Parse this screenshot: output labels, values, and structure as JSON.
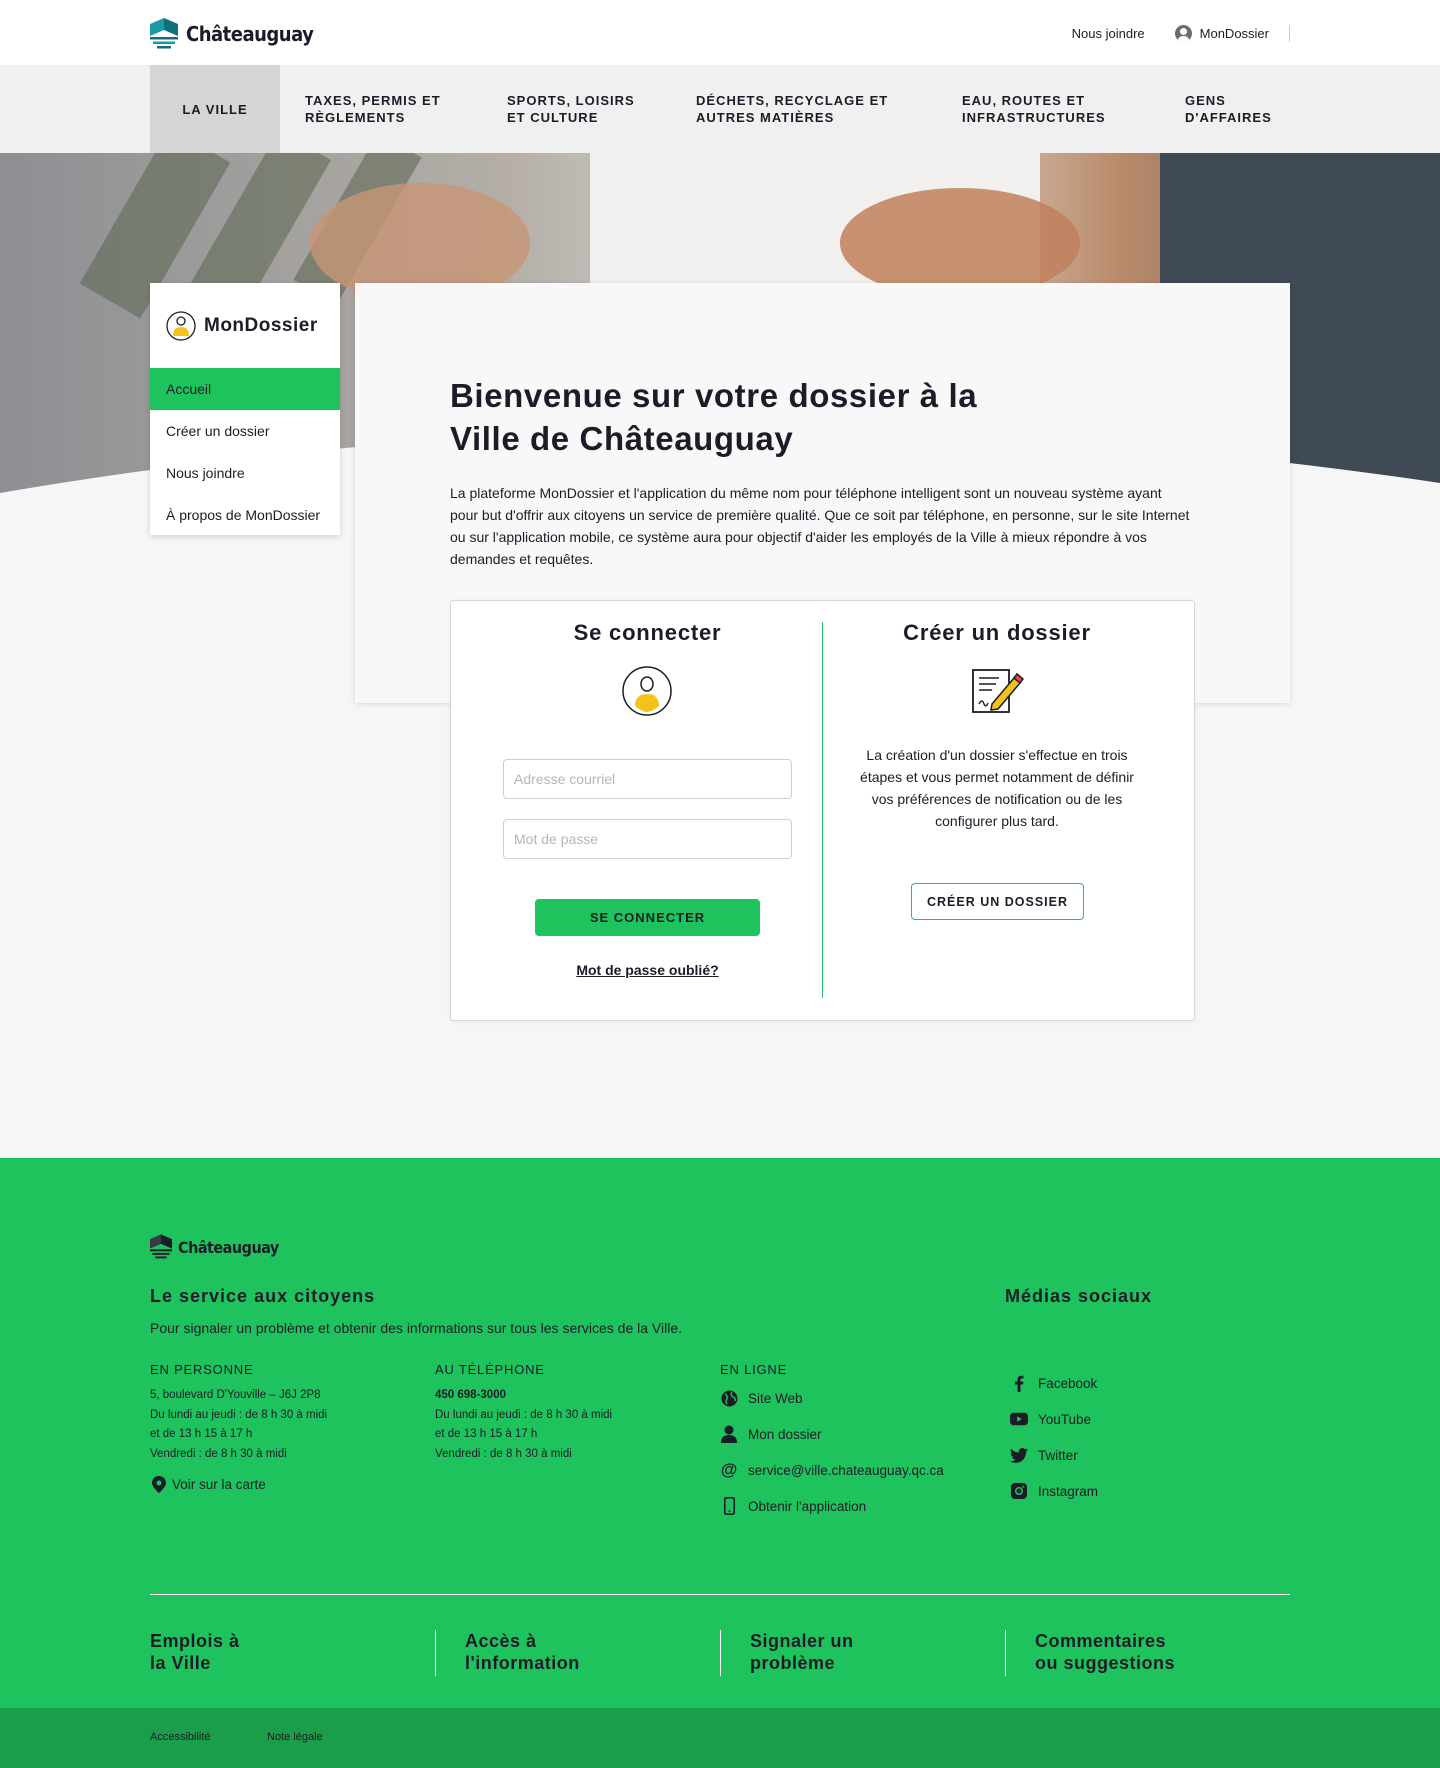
{
  "brand": {
    "name": "Châteauguay"
  },
  "header": {
    "contact_label": "Nous joindre",
    "dossier_label": "MonDossier"
  },
  "nav": {
    "items": [
      {
        "line1": "LA VILLE",
        "line2": ""
      },
      {
        "line1": "TAXES, PERMIS ET",
        "line2": "RÈGLEMENTS"
      },
      {
        "line1": "SPORTS, LOISIRS",
        "line2": "ET CULTURE"
      },
      {
        "line1": "DÉCHETS, RECYCLAGE ET",
        "line2": "AUTRES MATIÈRES"
      },
      {
        "line1": "EAU, ROUTES ET",
        "line2": "INFRASTRUCTURES"
      },
      {
        "line1": "GENS",
        "line2": "D'AFFAIRES"
      }
    ]
  },
  "sidebar": {
    "title": "MonDossier",
    "items": [
      "Accueil",
      "Créer un dossier",
      "Nous joindre",
      "À propos de MonDossier"
    ]
  },
  "main": {
    "title_line1": "Bienvenue sur votre dossier à la",
    "title_line2": "Ville de Châteauguay",
    "intro": "La plateforme MonDossier et l'application du même nom pour téléphone intelligent sont un nouveau système ayant pour but d'offrir aux citoyens un service de première qualité. Que ce soit par téléphone, en personne, sur le site Internet ou sur l'application mobile, ce système aura pour objectif d'aider les employés de la Ville à mieux répondre à vos demandes et requêtes."
  },
  "login": {
    "title": "Se connecter",
    "email_placeholder": "Adresse courriel",
    "password_placeholder": "Mot de passe",
    "button": "SE CONNECTER",
    "forgot": "Mot de passe oublié?"
  },
  "create": {
    "title": "Créer un dossier",
    "text": "La création d'un dossier s'effectue en trois étapes et vous permet notamment de définir vos préférences de notification ou de les configurer plus tard.",
    "button": "CRÉER UN DOSSIER"
  },
  "footer": {
    "service_title": "Le service aux citoyens",
    "service_sub": "Pour signaler un problème et obtenir des informations sur tous les services de la Ville.",
    "social_title": "Médias sociaux",
    "in_person": {
      "head": "EN PERSONNE",
      "lines": [
        "5, boulevard D'Youville – J6J 2P8",
        "Du lundi au jeudi : de 8 h 30 à midi",
        "et de 13 h 15 à 17 h",
        "Vendredi : de 8 h 30 à midi"
      ],
      "map_link": "Voir sur la carte"
    },
    "phone": {
      "head": "AU TÉLÉPHONE",
      "number": "450 698-3000",
      "lines": [
        "Du lundi au jeudi : de 8 h 30 à midi",
        "et de 13 h 15 à 17 h",
        "Vendredi : de 8 h 30 à midi"
      ]
    },
    "online": {
      "head": "EN LIGNE",
      "links": [
        "Site Web",
        "Mon dossier",
        "service@ville.chateauguay.qc.ca",
        "Obtenir l'application"
      ]
    },
    "social": [
      "Facebook",
      "YouTube",
      "Twitter",
      "Instagram"
    ],
    "big_links": [
      {
        "line1": "Emplois à",
        "line2": "la Ville"
      },
      {
        "line1": "Accès à",
        "line2": "l'information"
      },
      {
        "line1": "Signaler un",
        "line2": "problème"
      },
      {
        "line1": "Commentaires",
        "line2": "ou suggestions"
      }
    ],
    "legal": [
      "Accessibilité",
      "Note légale"
    ]
  },
  "colors": {
    "accent": "#1fc35d",
    "footer_dark": "#1a9e4a",
    "text": "#1c1c28"
  }
}
